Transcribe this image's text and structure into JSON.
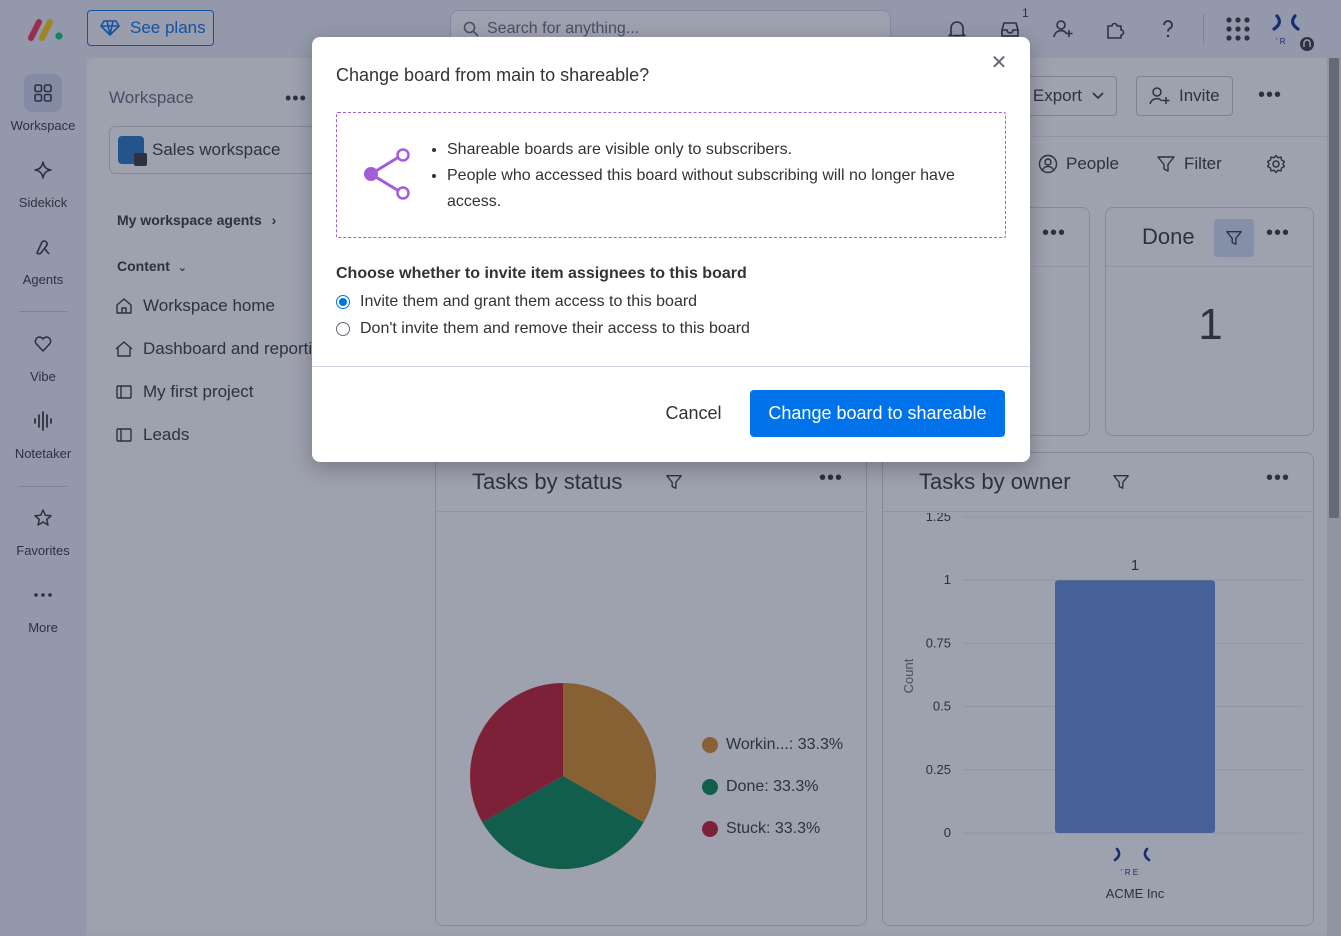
{
  "topbar": {
    "see_plans_label": "See plans",
    "search_placeholder": "Search for anything...",
    "inbox_badge": "1"
  },
  "leftnav": {
    "items": [
      {
        "label": "Workspace",
        "icon": "grid-icon"
      },
      {
        "label": "Sidekick",
        "icon": "sparkle-icon"
      },
      {
        "label": "Agents",
        "icon": "agent-icon"
      },
      {
        "label": "Vibe",
        "icon": "heart-icon"
      },
      {
        "label": "Notetaker",
        "icon": "waveform-icon"
      },
      {
        "label": "Favorites",
        "icon": "star-icon"
      },
      {
        "label": "More",
        "icon": "more-icon"
      }
    ]
  },
  "workspace": {
    "title": "Workspace",
    "selected": "Sales workspace",
    "agents_label": "My workspace agents",
    "content_label": "Content",
    "links": [
      {
        "label": "Workspace home",
        "icon": "home-icon"
      },
      {
        "label": "Dashboard and reporting",
        "icon": "dashboard-icon"
      },
      {
        "label": "My first project",
        "icon": "board-icon"
      },
      {
        "label": "Leads",
        "icon": "board-icon"
      }
    ]
  },
  "board": {
    "export_label": "Export",
    "invite_label": "Invite",
    "people_label": "People",
    "filter_label": "Filter",
    "done_widget": {
      "title": "Done",
      "value": "1"
    },
    "status_widget_title": "Tasks by status",
    "owner_widget_title": "Tasks by owner"
  },
  "chart_data": [
    {
      "type": "pie",
      "title": "Tasks by status",
      "slices": [
        {
          "label": "Workin...",
          "value": 33.3,
          "display": "Workin...: 33.3%",
          "color": "#d5891f"
        },
        {
          "label": "Done",
          "value": 33.3,
          "display": "Done: 33.3%",
          "color": "#00854d"
        },
        {
          "label": "Stuck",
          "value": 33.3,
          "display": "Stuck: 33.3%",
          "color": "#c4162a"
        }
      ]
    },
    {
      "type": "bar",
      "title": "Tasks by owner",
      "categories": [
        "ACME Inc"
      ],
      "values": [
        1
      ],
      "ylabel": "Count",
      "ylim": [
        0,
        1.25
      ],
      "yticks": [
        "0",
        "0.25",
        "0.5",
        "0.75",
        "1",
        "1.25"
      ],
      "data_labels": [
        "1"
      ],
      "color": "#5d8ad6"
    }
  ],
  "modal": {
    "title": "Change board from main to shareable?",
    "bullets": [
      "Shareable boards are visible only to subscribers.",
      "People who accessed this board without subscribing will no longer have access."
    ],
    "choose_label": "Choose whether to invite item assignees to this board",
    "options": [
      {
        "label": "Invite them and grant them access to this board",
        "checked": true
      },
      {
        "label": "Don't invite them and remove their access to this board",
        "checked": false
      }
    ],
    "cancel_label": "Cancel",
    "confirm_label": "Change board to shareable",
    "accent_color": "#0073ea",
    "share_icon_color": "#a25ddc"
  }
}
